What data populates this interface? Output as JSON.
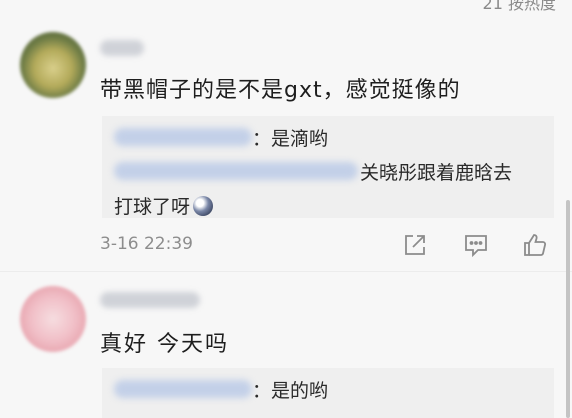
{
  "header": {
    "reply_link": "21 按热度"
  },
  "comments": [
    {
      "text": "带黑帽子的是不是gxt，感觉挺像的",
      "timestamp": "3-16 22:39",
      "replies": [
        {
          "text": "：是滴哟"
        },
        {
          "text_line1": "关晓彤跟着鹿晗去",
          "text_line2": "打球了呀"
        }
      ],
      "actions": [
        "share-icon",
        "comment-icon",
        "like-icon"
      ]
    },
    {
      "text": "真好  今天吗",
      "replies": [
        {
          "text": "：是的哟"
        }
      ]
    }
  ]
}
